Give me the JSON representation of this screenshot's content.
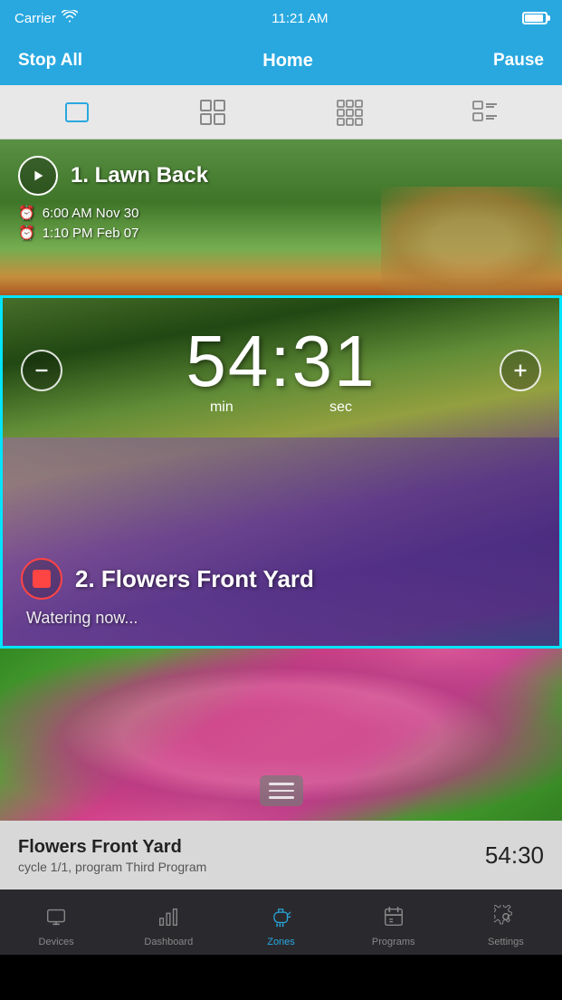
{
  "statusBar": {
    "carrier": "Carrier",
    "time": "11:21 AM",
    "wifiSymbol": "wifi"
  },
  "navBar": {
    "stopAll": "Stop All",
    "title": "Home",
    "pause": "Pause"
  },
  "viewSelector": {
    "views": [
      "single",
      "quad",
      "grid",
      "list"
    ]
  },
  "zones": [
    {
      "id": 1,
      "name": "1. Lawn Back",
      "schedule1": "6:00 AM Nov 30",
      "schedule2": "1:10 PM Feb 07",
      "active": false,
      "backgroundDesc": "green lawn"
    },
    {
      "id": 2,
      "name": "2. Flowers Front Yard",
      "timer": "54:31",
      "timerMin": "min",
      "timerSec": "sec",
      "status": "Watering now...",
      "active": true,
      "backgroundDesc": "flower garden"
    },
    {
      "id": 3,
      "name": "Flowers Front Yard",
      "backgroundDesc": "pink flowers"
    }
  ],
  "infoBar": {
    "zoneName": "Flowers Front Yard",
    "sub": "cycle 1/1, program Third Program",
    "timer": "54:30"
  },
  "tabBar": {
    "tabs": [
      {
        "id": "devices",
        "label": "Devices",
        "icon": "monitor"
      },
      {
        "id": "dashboard",
        "label": "Dashboard",
        "icon": "bar-chart"
      },
      {
        "id": "zones",
        "label": "Zones",
        "icon": "watering-can",
        "active": true
      },
      {
        "id": "programs",
        "label": "Programs",
        "icon": "calendar"
      },
      {
        "id": "settings",
        "label": "Settings",
        "icon": "wrench"
      }
    ]
  }
}
